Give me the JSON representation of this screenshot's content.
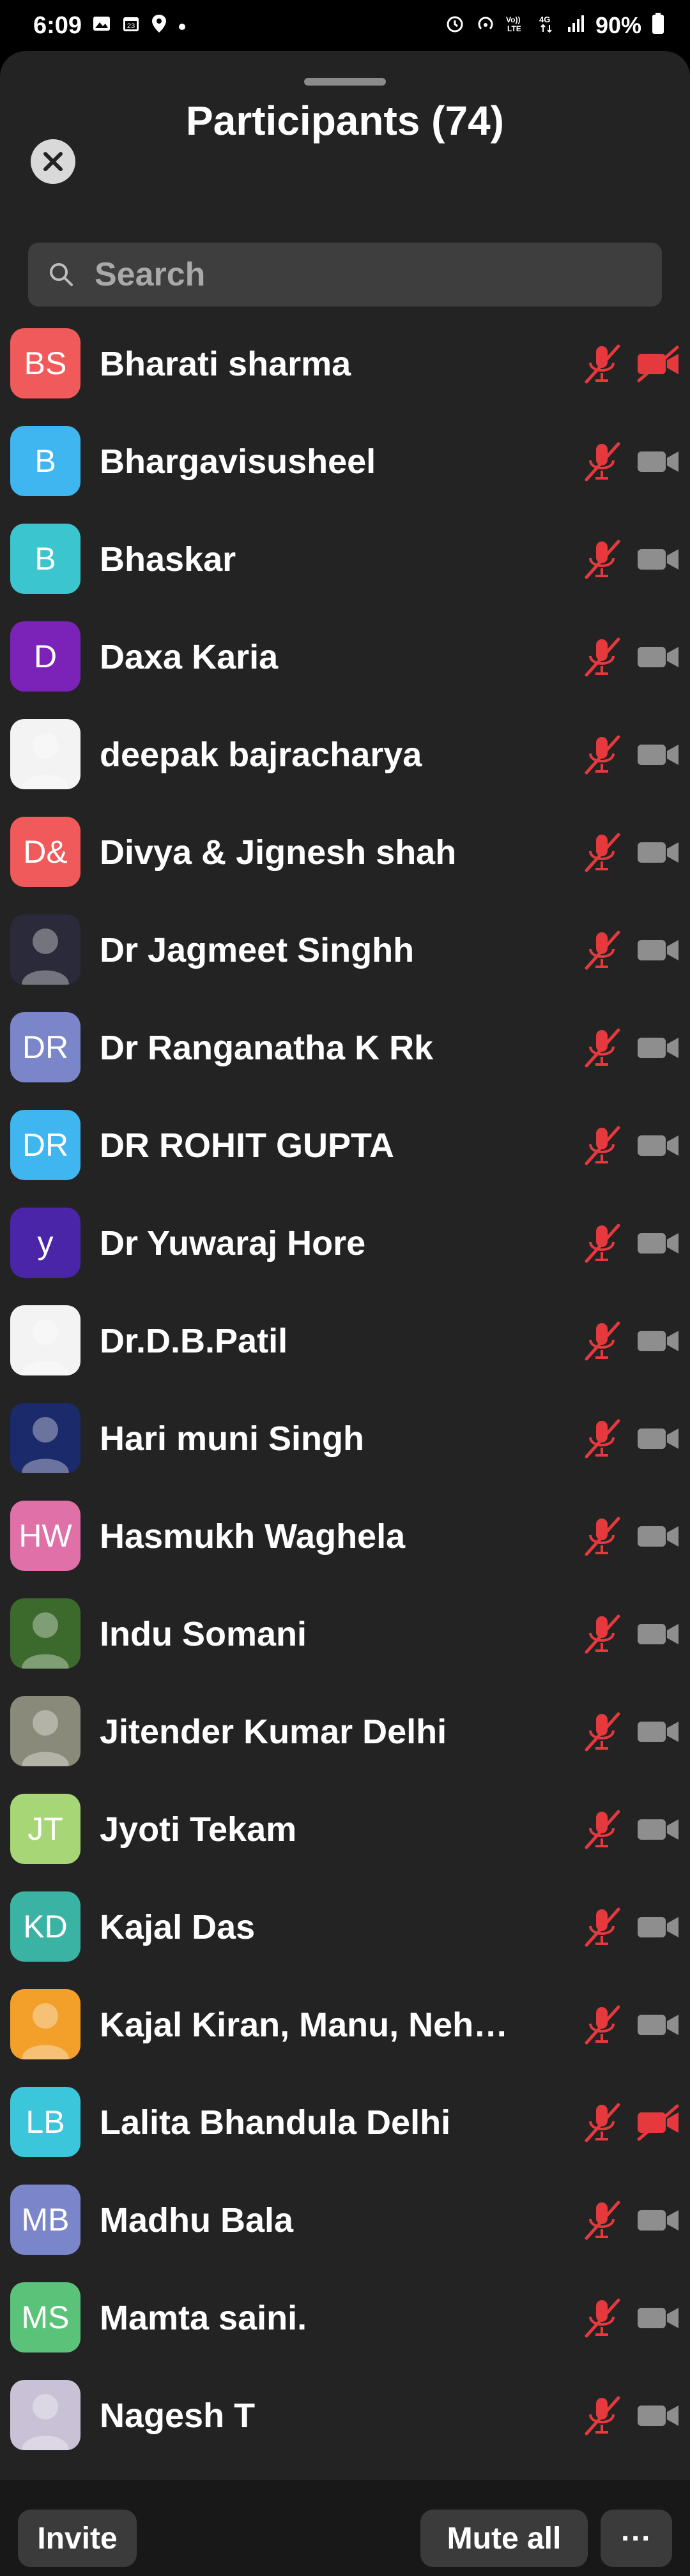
{
  "status_bar": {
    "time": "6:09",
    "left_icons": [
      "image-icon",
      "calendar-icon",
      "location-icon",
      "dot-icon"
    ],
    "right_icons": [
      "alarm-icon",
      "hotspot-icon",
      "volte-icon",
      "4g-icon",
      "signal-icon"
    ],
    "battery": "90%"
  },
  "header": {
    "title": "Participants (74)"
  },
  "search": {
    "placeholder": "Search",
    "value": ""
  },
  "participants": [
    {
      "name": "Bharati sharma",
      "initials": "BS",
      "avatar_color": "#f05a5a",
      "avatar_type": "initials",
      "mic_muted": true,
      "video_off": true
    },
    {
      "name": "Bhargavisusheel",
      "initials": "B",
      "avatar_color": "#3fb6ef",
      "avatar_type": "initials",
      "mic_muted": true,
      "video_off": false
    },
    {
      "name": "Bhaskar",
      "initials": "B",
      "avatar_color": "#3bc6cf",
      "avatar_type": "initials",
      "mic_muted": true,
      "video_off": false
    },
    {
      "name": "Daxa Karia",
      "initials": "D",
      "avatar_color": "#7b22b8",
      "avatar_type": "initials",
      "mic_muted": true,
      "video_off": false
    },
    {
      "name": "deepak bajracharya",
      "initials": "",
      "avatar_color": "#f3f3f3",
      "avatar_type": "photo",
      "mic_muted": true,
      "video_off": false
    },
    {
      "name": "Divya & Jignesh shah",
      "initials": "D&",
      "avatar_color": "#f05a5a",
      "avatar_type": "initials",
      "mic_muted": true,
      "video_off": false
    },
    {
      "name": "Dr Jagmeet Singhh",
      "initials": "",
      "avatar_color": "#2a2a3a",
      "avatar_type": "photo",
      "mic_muted": true,
      "video_off": false
    },
    {
      "name": "Dr Ranganatha K Rk",
      "initials": "DR",
      "avatar_color": "#7a86c9",
      "avatar_type": "initials",
      "mic_muted": true,
      "video_off": false
    },
    {
      "name": "DR ROHIT GUPTA",
      "initials": "DR",
      "avatar_color": "#3fb6ef",
      "avatar_type": "initials",
      "mic_muted": true,
      "video_off": false
    },
    {
      "name": "Dr Yuwaraj Hore",
      "initials": "y",
      "avatar_color": "#4a25a8",
      "avatar_type": "initials",
      "mic_muted": true,
      "video_off": false
    },
    {
      "name": "Dr.D.B.Patil",
      "initials": "",
      "avatar_color": "#f3f3f3",
      "avatar_type": "photo",
      "mic_muted": true,
      "video_off": false
    },
    {
      "name": "Hari muni Singh",
      "initials": "",
      "avatar_color": "#1b2a6a",
      "avatar_type": "photo",
      "mic_muted": true,
      "video_off": false
    },
    {
      "name": "Hasmukh Waghela",
      "initials": "HW",
      "avatar_color": "#e070a8",
      "avatar_type": "initials",
      "mic_muted": true,
      "video_off": false
    },
    {
      "name": "Indu Somani",
      "initials": "",
      "avatar_color": "#3c6a2c",
      "avatar_type": "photo",
      "mic_muted": true,
      "video_off": false
    },
    {
      "name": "Jitender Kumar Delhi",
      "initials": "",
      "avatar_color": "#8a8a7a",
      "avatar_type": "photo",
      "mic_muted": true,
      "video_off": false
    },
    {
      "name": "Jyoti Tekam",
      "initials": "JT",
      "avatar_color": "#a6d676",
      "avatar_type": "initials",
      "mic_muted": true,
      "video_off": false
    },
    {
      "name": "Kajal Das",
      "initials": "KD",
      "avatar_color": "#3bb3a4",
      "avatar_type": "initials",
      "mic_muted": true,
      "video_off": false
    },
    {
      "name": "Kajal Kiran, Manu, Neha…",
      "initials": "",
      "avatar_color": "#f2a02a",
      "avatar_type": "photo",
      "mic_muted": true,
      "video_off": false
    },
    {
      "name": "Lalita Bhandula Delhi",
      "initials": "LB",
      "avatar_color": "#3bc6dc",
      "avatar_type": "initials",
      "mic_muted": true,
      "video_off": true
    },
    {
      "name": "Madhu Bala",
      "initials": "MB",
      "avatar_color": "#7a86c9",
      "avatar_type": "initials",
      "mic_muted": true,
      "video_off": false
    },
    {
      "name": "Mamta saini.",
      "initials": "MS",
      "avatar_color": "#5bc27a",
      "avatar_type": "initials",
      "mic_muted": true,
      "video_off": false
    },
    {
      "name": "Nagesh T",
      "initials": "",
      "avatar_color": "#c9c2d6",
      "avatar_type": "photo",
      "mic_muted": true,
      "video_off": false
    }
  ],
  "footer": {
    "invite_label": "Invite",
    "mute_all_label": "Mute all",
    "more_label": "···"
  },
  "colors": {
    "sheet_bg": "#232323",
    "muted_red": "#e5393e",
    "icon_gray": "#8e8e8e"
  }
}
